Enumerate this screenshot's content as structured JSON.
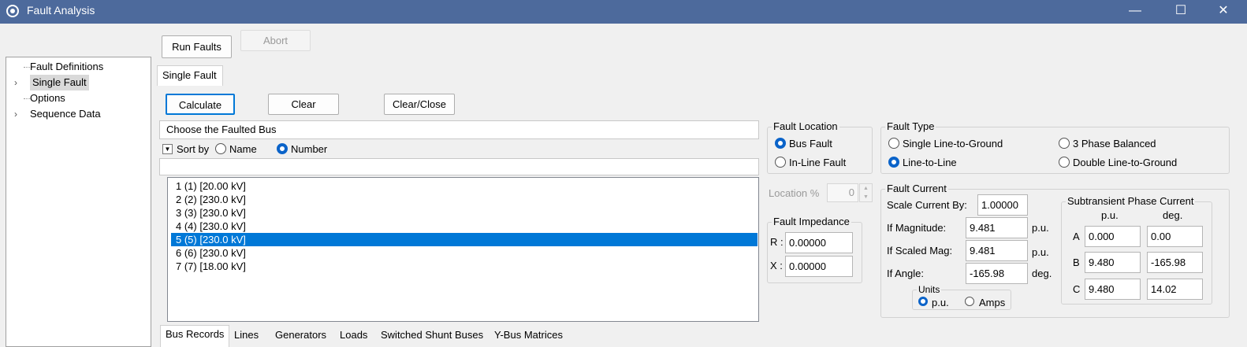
{
  "window": {
    "title": "Fault Analysis",
    "min": "—",
    "max": "☐",
    "close": "✕"
  },
  "toolbar": {
    "run": "Run Faults",
    "abort": "Abort"
  },
  "tree": {
    "items": [
      "Fault Definitions",
      "Single Fault",
      "Options",
      "Sequence Data"
    ]
  },
  "tab": "Single Fault",
  "actions": {
    "calculate": "Calculate",
    "clear": "Clear",
    "clear_close": "Clear/Close"
  },
  "bus_panel": {
    "header": "Choose the Faulted Bus",
    "sort_by": "Sort by",
    "name": "Name",
    "number": "Number",
    "filter": "",
    "sort_selected": "Number",
    "buses": [
      "1 (1)  [20.00 kV]",
      "2 (2)  [230.0 kV]",
      "3 (3)  [230.0 kV]",
      "4 (4)  [230.0 kV]",
      "5 (5)  [230.0 kV]",
      "6 (6)  [230.0 kV]",
      "7 (7)  [18.00 kV]"
    ],
    "selected_index": 4
  },
  "fault_location": {
    "title": "Fault Location",
    "bus_fault": "Bus Fault",
    "inline_fault": "In-Line Fault",
    "selected": "Bus Fault",
    "location_label": "Location %",
    "location_value": "0"
  },
  "fault_impedance": {
    "title": "Fault Impedance",
    "r_label": "R :",
    "r_value": "0.00000",
    "x_label": "X :",
    "x_value": "0.00000"
  },
  "fault_type": {
    "title": "Fault Type",
    "slg": "Single Line-to-Ground",
    "three_phase": "3 Phase Balanced",
    "ll": "Line-to-Line",
    "dlg": "Double Line-to-Ground",
    "selected": "Line-to-Line"
  },
  "fault_current": {
    "title": "Fault Current",
    "scale_label": "Scale Current By:",
    "scale_value": "1.00000",
    "mag_label": "If Magnitude:",
    "mag_value": "9.481",
    "mag_unit": "p.u.",
    "scaled_label": "If Scaled Mag:",
    "scaled_value": "9.481",
    "scaled_unit": "p.u.",
    "angle_label": "If Angle:",
    "angle_value": "-165.98",
    "angle_unit": "deg.",
    "units_title": "Units",
    "units_pu": "p.u.",
    "units_amps": "Amps",
    "units_selected": "p.u."
  },
  "subtransient": {
    "title": "Subtransient Phase Current",
    "col_pu": "p.u.",
    "col_deg": "deg.",
    "rows": [
      {
        "phase": "A",
        "pu": "0.000",
        "deg": "0.00"
      },
      {
        "phase": "B",
        "pu": "9.480",
        "deg": "-165.98"
      },
      {
        "phase": "C",
        "pu": "9.480",
        "deg": "14.02"
      }
    ]
  },
  "bottom_tabs": [
    "Bus Records",
    "Lines",
    "Generators",
    "Loads",
    "Switched Shunt Buses",
    "Y-Bus Matrices"
  ],
  "colors": {
    "titlebar": "#4d6a9c",
    "selection": "#0078d7",
    "radio": "#0a63c9"
  }
}
